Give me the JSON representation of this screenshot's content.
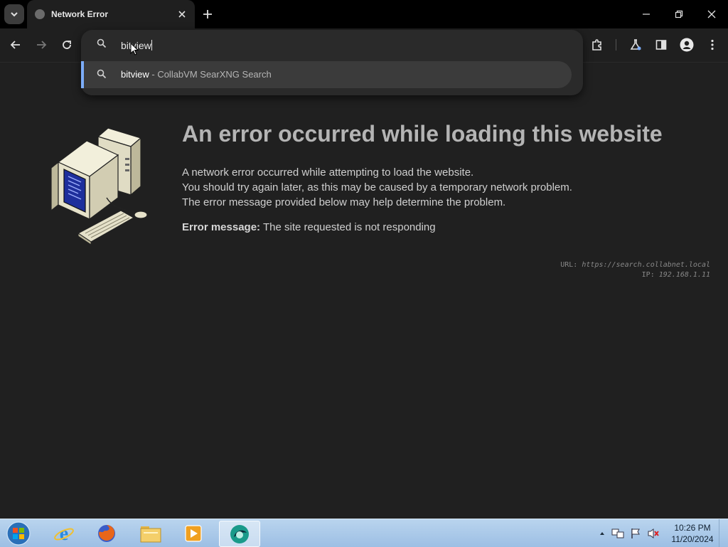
{
  "browser": {
    "tab": {
      "title": "Network Error"
    },
    "omnibox": {
      "typed_text": "bitview",
      "suggestion": {
        "query": "bitview",
        "separator": " - ",
        "provider": "CollabVM SearXNG Search"
      }
    }
  },
  "page": {
    "headline": "An error occurred while loading this website",
    "description_lines": [
      "A network error occurred while attempting to load the website.",
      "You should try again later, as this may be caused by a temporary network problem.",
      "The error message provided below may help determine the problem."
    ],
    "error_label": "Error message:",
    "error_value": "The site requested is not responding",
    "url_label": "URL:",
    "url_value": "https://search.collabnet.local",
    "ip_label": "IP:",
    "ip_value": "192.168.1.11"
  },
  "taskbar": {
    "clock": {
      "time": "10:26 PM",
      "date": "11/20/2024"
    },
    "apps": [
      "internet-explorer",
      "firefox",
      "file-explorer",
      "media-player",
      "browser-active"
    ]
  },
  "colors": {
    "page_bg": "#202020",
    "accent": "#7cacf8",
    "headline": "#b4b4b4"
  }
}
